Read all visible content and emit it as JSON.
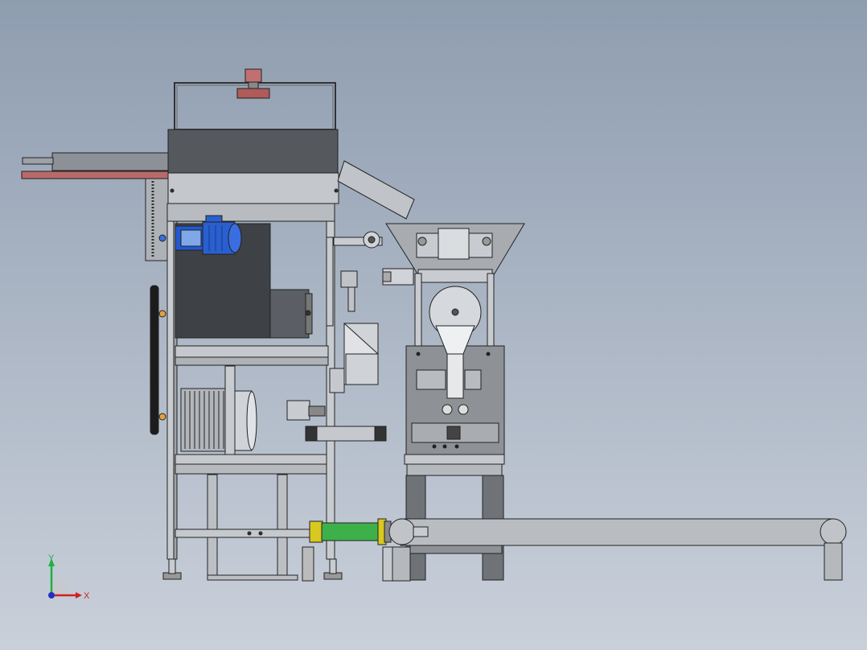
{
  "view": {
    "colors": {
      "steel": "#c8ccd0",
      "steel_dark": "#8a8f95",
      "outline": "#222222",
      "dark_panel": "#4a4d53",
      "motor_blue": "#2a5fd0",
      "rust": "#b06060",
      "conveyor": "#b8bcc0",
      "pipe_green": "#3db04a",
      "pipe_yellow": "#e0d030"
    }
  },
  "triad": {
    "x_label": "X",
    "y_label": "Y",
    "x_color": "#d02020",
    "y_color": "#20b040",
    "z_color": "#2030c0"
  }
}
